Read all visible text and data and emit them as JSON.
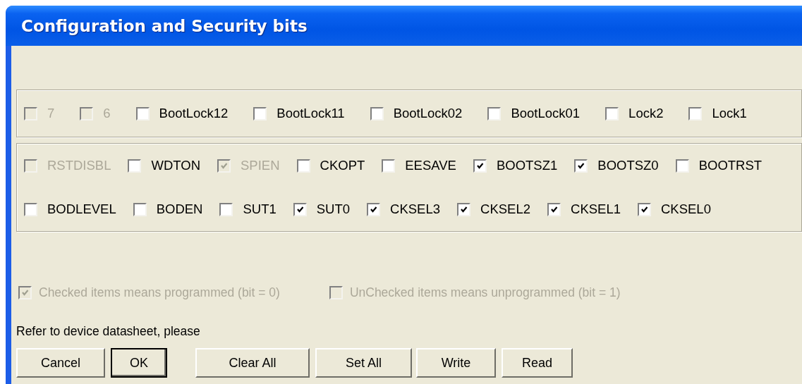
{
  "window": {
    "title": "Configuration and Security bits"
  },
  "groups": [
    {
      "rows": [
        [
          {
            "label": "7",
            "checked": false,
            "disabled": true
          },
          {
            "label": "6",
            "checked": false,
            "disabled": true
          },
          {
            "label": "BootLock12",
            "checked": false,
            "disabled": false
          },
          {
            "label": "BootLock11",
            "checked": false,
            "disabled": false
          },
          {
            "label": "BootLock02",
            "checked": false,
            "disabled": false
          },
          {
            "label": "BootLock01",
            "checked": false,
            "disabled": false
          },
          {
            "label": "Lock2",
            "checked": false,
            "disabled": false
          },
          {
            "label": "Lock1",
            "checked": false,
            "disabled": false
          }
        ]
      ]
    },
    {
      "rows": [
        [
          {
            "label": "RSTDISBL",
            "checked": false,
            "disabled": true
          },
          {
            "label": "WDTON",
            "checked": false,
            "disabled": false
          },
          {
            "label": "SPIEN",
            "checked": true,
            "disabled": true
          },
          {
            "label": "CKOPT",
            "checked": false,
            "disabled": false
          },
          {
            "label": "EESAVE",
            "checked": false,
            "disabled": false
          },
          {
            "label": "BOOTSZ1",
            "checked": true,
            "disabled": false
          },
          {
            "label": "BOOTSZ0",
            "checked": true,
            "disabled": false
          },
          {
            "label": "BOOTRST",
            "checked": false,
            "disabled": false
          }
        ],
        [
          {
            "label": "BODLEVEL",
            "checked": false,
            "disabled": false
          },
          {
            "label": "BODEN",
            "checked": false,
            "disabled": false
          },
          {
            "label": "SUT1",
            "checked": false,
            "disabled": false
          },
          {
            "label": "SUT0",
            "checked": true,
            "disabled": false
          },
          {
            "label": "CKSEL3",
            "checked": true,
            "disabled": false
          },
          {
            "label": "CKSEL2",
            "checked": true,
            "disabled": false
          },
          {
            "label": "CKSEL1",
            "checked": true,
            "disabled": false
          },
          {
            "label": "CKSEL0",
            "checked": true,
            "disabled": false
          }
        ]
      ]
    }
  ],
  "legend": [
    {
      "label": "Checked items means programmed (bit = 0)",
      "checked": true,
      "disabled": true
    },
    {
      "label": "UnChecked items means unprogrammed (bit = 1)",
      "checked": false,
      "disabled": true
    }
  ],
  "note": "Refer to device datasheet, please",
  "buttons": [
    {
      "label": "Cancel",
      "default": false
    },
    {
      "label": "OK",
      "default": true
    },
    {
      "label": "Clear All",
      "default": false
    },
    {
      "label": "Set All",
      "default": false
    },
    {
      "label": "Write",
      "default": false
    },
    {
      "label": "Read",
      "default": false
    }
  ]
}
